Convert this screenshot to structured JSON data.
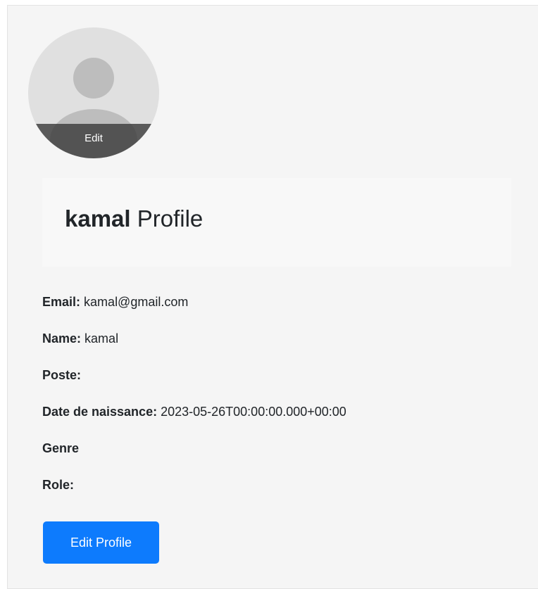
{
  "avatar": {
    "edit_label": "Edit"
  },
  "profile": {
    "username": "kamal",
    "title_suffix": "Profile"
  },
  "details": [
    {
      "label": "Email:",
      "value": "kamal@gmail.com"
    },
    {
      "label": "Name:",
      "value": "kamal"
    },
    {
      "label": "Poste:",
      "value": ""
    },
    {
      "label": "Date de naissance:",
      "value": "2023-05-26T00:00:00.000+00:00"
    },
    {
      "label": "Genre",
      "value": ""
    },
    {
      "label": "Role:",
      "value": ""
    }
  ],
  "actions": {
    "edit_profile_label": "Edit Profile"
  },
  "colors": {
    "primary": "#0d7bfd",
    "card_background": "#f5f5f5"
  }
}
